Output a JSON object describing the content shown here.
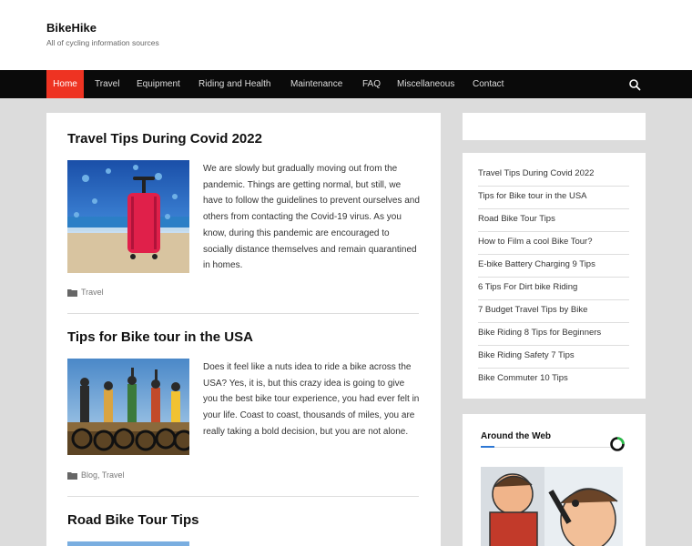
{
  "site": {
    "title": "BikeHike",
    "tagline": "All of cycling information sources"
  },
  "nav": {
    "items": [
      "Home",
      "Travel",
      "Equipment",
      "Riding and Health",
      "Maintenance",
      "FAQ",
      "Miscellaneous",
      "Contact"
    ],
    "active_index": 0,
    "search_icon": "search-icon"
  },
  "posts": [
    {
      "title": "Travel Tips During Covid 2022",
      "excerpt": "We are slowly but gradually moving out from the pandemic. Things are getting normal, but still, we have to follow the guidelines to prevent ourselves and others from contacting the Covid-19 virus. As you know, during this pandemic are encouraged to socially distance themselves and remain quarantined in homes.",
      "categories": "Travel",
      "category_icon": "folder-icon"
    },
    {
      "title": "Tips for Bike tour in the USA",
      "excerpt": "Does it feel like a nuts idea to ride a bike across the USA? Yes, it is, but this crazy idea is going to give you the best bike tour experience, you had ever felt in your life. Coast to coast, thousands of miles, you are really taking a bold decision, but you are not alone.",
      "categories": "Blog, Travel",
      "category_icon": "folder-icon"
    },
    {
      "title": "Road Bike Tour Tips"
    }
  ],
  "sidebar": {
    "recent_posts": [
      "Travel Tips During Covid 2022",
      "Tips for Bike tour in the USA",
      "Road Bike Tour Tips",
      "How to Film a cool Bike Tour?",
      "E-bike Battery Charging 9 Tips",
      "6 Tips For Dirt bike Riding",
      "7 Budget Travel Tips by Bike",
      "Bike Riding 8 Tips for Beginners",
      "Bike Riding Safety 7 Tips",
      "Bike Commuter 10 Tips"
    ],
    "around_web_title": "Around the Web"
  },
  "colors": {
    "nav_bg": "#0a0a0a",
    "nav_active": "#ee3322",
    "accent_blue": "#2d77d4"
  }
}
